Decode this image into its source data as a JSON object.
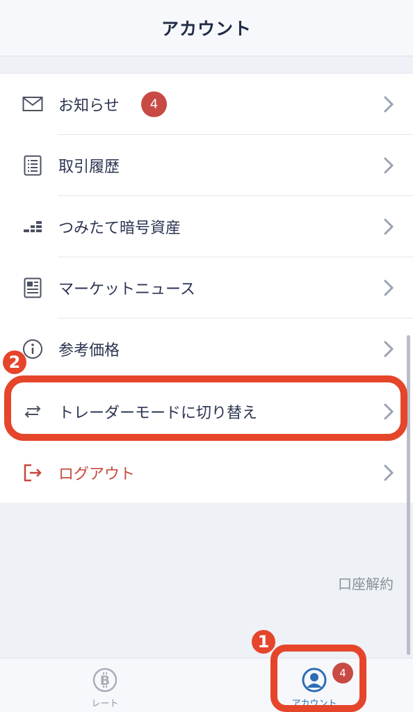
{
  "header": {
    "title": "アカウント"
  },
  "menu": {
    "items": [
      {
        "label": "お知らせ",
        "badge": "4",
        "icon": "mail-icon"
      },
      {
        "label": "取引履歴",
        "icon": "list-icon"
      },
      {
        "label": "つみたて暗号資産",
        "icon": "accumulation-icon"
      },
      {
        "label": "マーケットニュース",
        "icon": "news-icon"
      },
      {
        "label": "参考価格",
        "icon": "info-icon"
      },
      {
        "label": "トレーダーモードに切り替え",
        "icon": "switch-arrows-icon"
      },
      {
        "label": "ログアウト",
        "icon": "logout-icon"
      }
    ]
  },
  "footer": {
    "cancel_label": "口座解約"
  },
  "tabbar": {
    "tabs": [
      {
        "label": "レート",
        "icon": "bitcoin-icon"
      },
      {
        "label": "アカウント",
        "icon": "user-icon",
        "badge": "4"
      }
    ]
  },
  "annotations": {
    "marker1": "1",
    "marker2": "2"
  },
  "colors": {
    "accent": "#2c6db5",
    "badge": "#c84a44",
    "annotation": "#e5452b",
    "logout": "#c4493e"
  }
}
